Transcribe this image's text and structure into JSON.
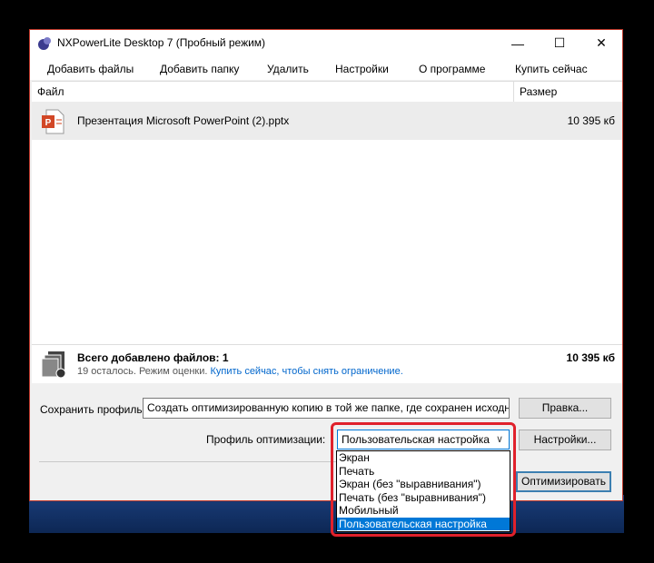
{
  "window": {
    "title": "NXPowerLite Desktop 7 (Пробный режим)"
  },
  "window_controls": {
    "minimize": "—",
    "maximize": "☐",
    "close": "✕"
  },
  "menu": {
    "items": [
      {
        "label": "Добавить файлы"
      },
      {
        "label": "Добавить папку"
      },
      {
        "label": "Удалить"
      },
      {
        "label": "Настройки"
      },
      {
        "label": "О программе"
      },
      {
        "label": "Купить сейчас"
      }
    ]
  },
  "filelist": {
    "columns": {
      "file": "Файл",
      "size": "Размер"
    },
    "rows": [
      {
        "name": "Презентация Microsoft PowerPoint (2).pptx",
        "size": "10 395 кб",
        "icon": "powerpoint-file-icon"
      }
    ]
  },
  "summary": {
    "title": "Всего добавлено файлов: 1",
    "total": "10 395 кб",
    "remaining": "19 осталось. Режим оценки.",
    "link": "Купить сейчас, чтобы снять ограничение."
  },
  "save_profile": {
    "label": "Сохранить профиль:",
    "value": "Создать оптимизированную копию в той же папке, где сохранен исходный",
    "edit_button": "Правка..."
  },
  "optimization": {
    "label": "Профиль оптимизации:",
    "selected": "Пользовательская настройка",
    "settings_button": "Настройки...",
    "options": [
      "Экран",
      "Печать",
      "Экран (без \"выравнивания\")",
      "Печать (без \"выравнивания\")",
      "Мобильный",
      "Пользовательская настройка"
    ],
    "selected_index": 5
  },
  "optimize_button": "Оптимизировать",
  "colors": {
    "highlight": "#e0212b",
    "selection": "#0078d7",
    "link": "#0066cc",
    "window_border": "#c0392b"
  }
}
